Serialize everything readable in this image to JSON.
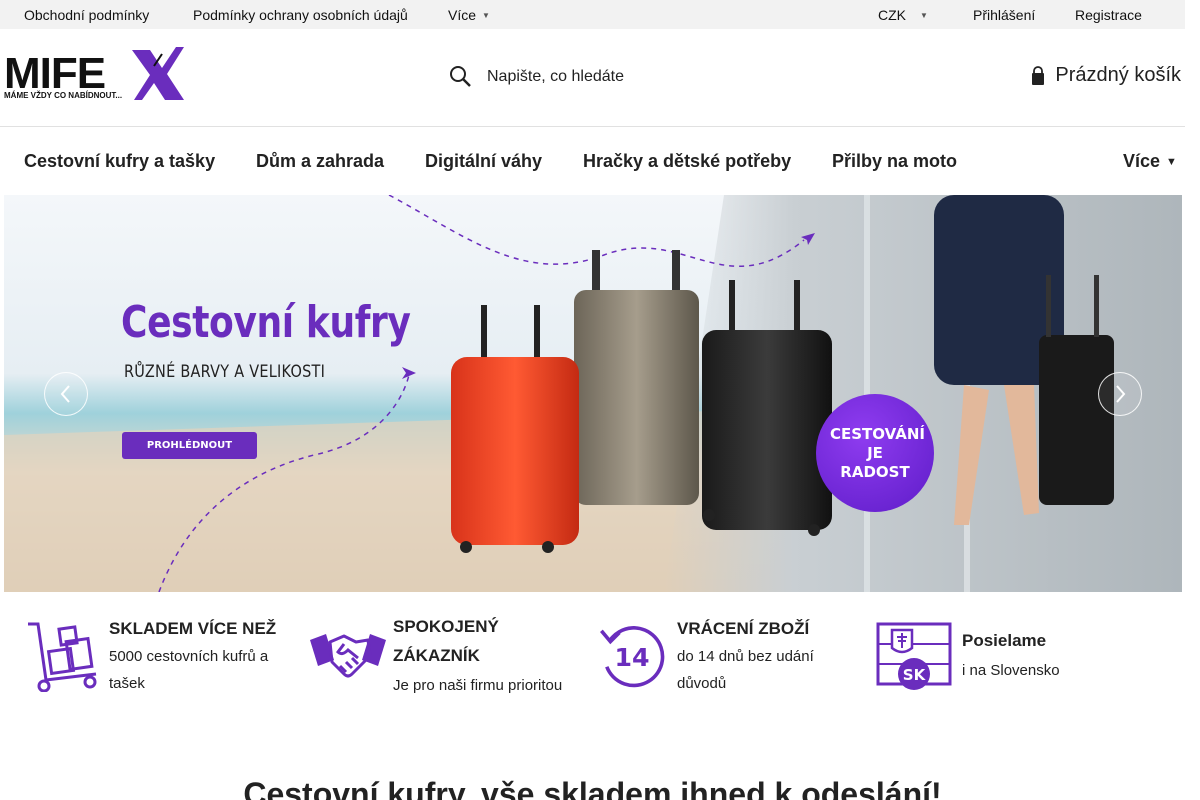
{
  "topbar": {
    "terms": "Obchodní podmínky",
    "privacy": "Podmínky ochrany osobních údajů",
    "more": "Více",
    "currency": "CZK",
    "login": "Přihlášení",
    "register": "Registrace"
  },
  "header": {
    "logo_text": "MIFEX",
    "logo_tagline": "MÁME VŽDY CO NABÍDNOUT...",
    "search_placeholder": "Napište, co hledáte",
    "cart_label": "Prázdný košík"
  },
  "nav": {
    "items": [
      {
        "label": "Cestovní kufry a tašky"
      },
      {
        "label": "Dům a zahrada"
      },
      {
        "label": "Digitální váhy"
      },
      {
        "label": "Hračky a dětské potřeby"
      },
      {
        "label": "Přilby na moto"
      }
    ],
    "more": "Více"
  },
  "banner": {
    "title": "Cestovní kufry",
    "subtitle": "RŮZNÉ BARVY A VELIKOSTI",
    "button": "PROHLÉDNOUT",
    "badge": "CESTOVÁNÍ JE RADOST"
  },
  "features": [
    {
      "heading": "SKLADEM VÍCE NEŽ",
      "text": "5000 cestovních kufrů a tašek",
      "icon": "trolley-boxes-icon"
    },
    {
      "heading": "SPOKOJENÝ ZÁKAZNÍK",
      "text": "Je pro naši firmu prioritou",
      "icon": "handshake-icon"
    },
    {
      "heading": "VRÁCENÍ ZBOŽÍ",
      "text": "do 14 dnů bez udání důvodů",
      "icon": "return-14-icon"
    },
    {
      "heading": "Posielame",
      "text": "i na Slovensko",
      "icon": "slovakia-flag-icon"
    }
  ],
  "section_heading": "Cestovní kufry, vše skladem ihned k odeslání!",
  "colors": {
    "brand": "#6a2dbd",
    "topbar_bg": "#f2f2f2",
    "text": "#222222"
  }
}
